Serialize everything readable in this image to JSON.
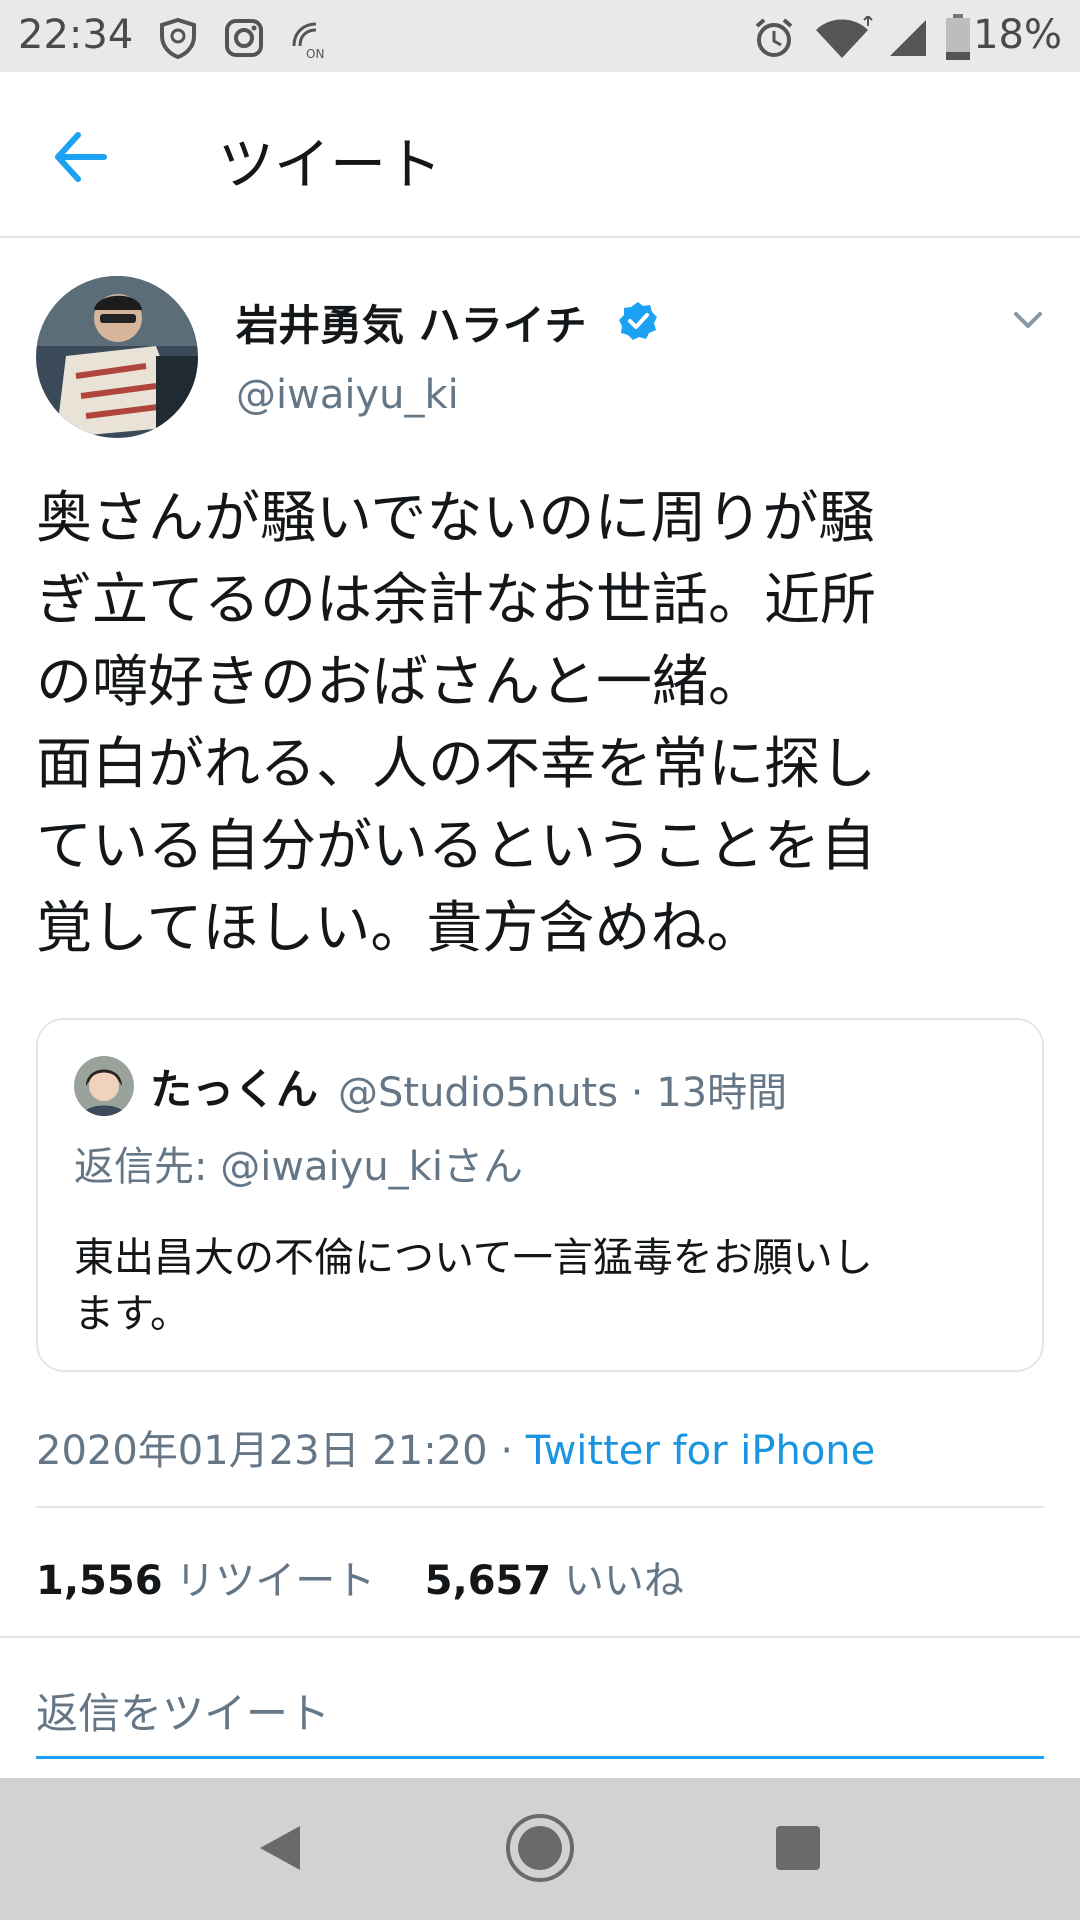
{
  "status_bar": {
    "time": "22:34",
    "battery_percent": "18%",
    "left_icons": [
      "shield-icon",
      "instagram-icon",
      "nfc-icon"
    ],
    "right_icons": [
      "alarm-icon",
      "wifi-icon",
      "signal-icon",
      "battery-icon"
    ],
    "battery_level": 0.18
  },
  "header": {
    "title": "ツイート",
    "back_icon": "back-arrow-icon"
  },
  "tweet": {
    "author_name": "岩井勇気 ハライチ",
    "author_handle": "@iwaiyu_ki",
    "verified": true,
    "text_lines": [
      "奥さんが騒いでないのに周りが騒",
      "ぎ立てるのは余計なお世話。近所",
      "の噂好きのおばさんと一緒。",
      "面白がれる、人の不幸を常に探し",
      "ている自分がいるということを自",
      "覚してほしい。貴方含めね。"
    ],
    "timestamp": "2020年01月23日 21:20",
    "separator": "·",
    "source": "Twitter for iPhone",
    "retweets_count": "1,556",
    "retweets_label": "リツイート",
    "likes_count": "5,657",
    "likes_label": "いいね"
  },
  "quoted_tweet": {
    "author_name": "たっくん",
    "author_handle_time": "@Studio5nuts · 13時間",
    "reply_to": "返信先: @iwaiyu_kiさん",
    "text_line_1": "東出昌大の不倫について一言猛毒をお願いし",
    "text_line_2": "ます。"
  },
  "reply": {
    "placeholder": "返信をツイート"
  },
  "colors": {
    "accent": "#1da1f2",
    "link": "#1b95e0",
    "secondary_text": "#657786",
    "divider": "#e1e8ed"
  }
}
